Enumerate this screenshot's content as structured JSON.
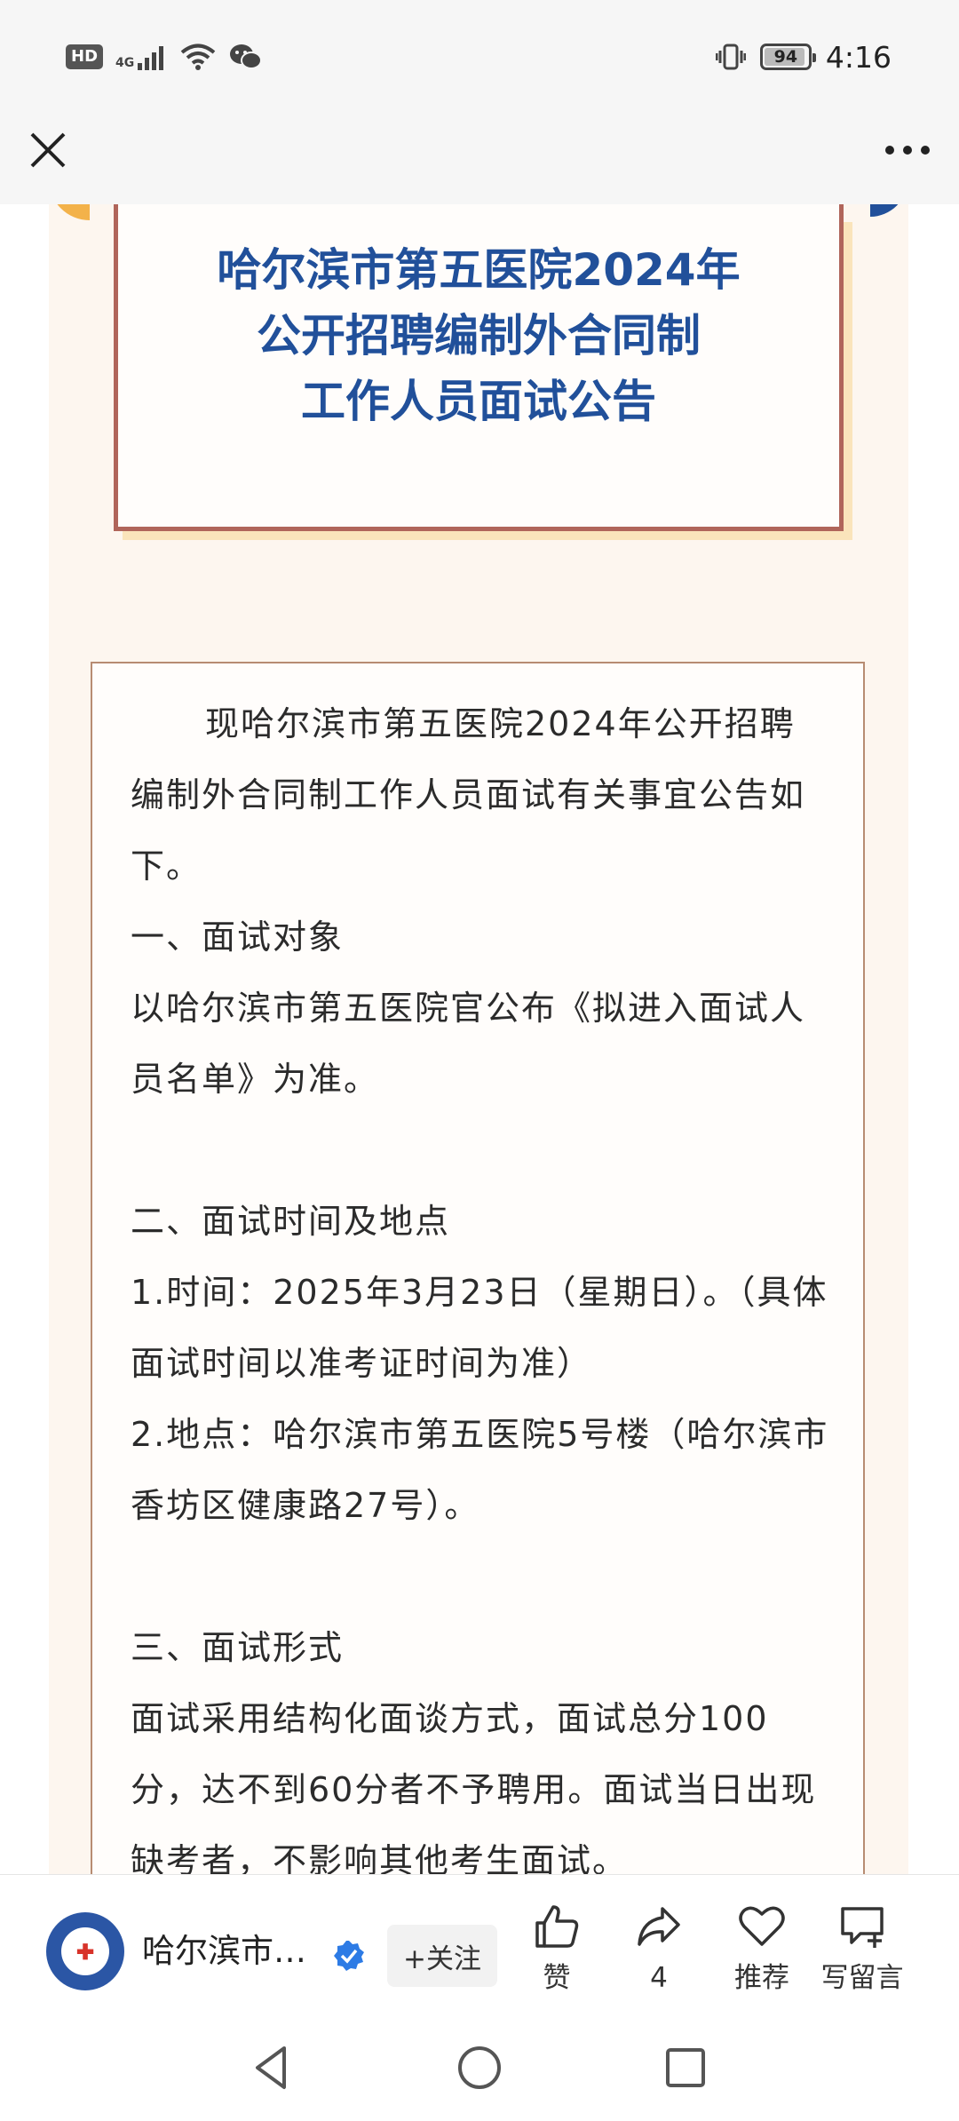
{
  "status_bar": {
    "hd": "HD",
    "network": "4G",
    "battery_level": "94",
    "battery_fraction": 0.94,
    "time": "4:16",
    "icons": [
      "signal-icon",
      "wifi-icon",
      "wechat-icon",
      "vibrate-icon",
      "battery-icon"
    ]
  },
  "title_bar": {
    "close_icon": "close-icon",
    "more_icon": "more-icon"
  },
  "article": {
    "title_lines": [
      "哈尔滨市第五医院2024年",
      "公开招聘编制外合同制",
      "工作人员面试公告"
    ],
    "paragraphs": [
      "现哈尔滨市第五医院2024年公开招聘编制外合同制工作人员面试有关事宜公告如下。",
      "一、面试对象",
      "以哈尔滨市第五医院官公布《拟进入面试人员名单》为准。",
      "二、面试时间及地点",
      "1.时间：2025年3月23日（星期日）。（具体面试时间以准考证时间为准）",
      "2.地点：哈尔滨市第五医院5号楼（哈尔滨市香坊区健康路27号）。",
      "三、面试形式",
      "面试采用结构化面谈方式，面试总分100分，达不到60分者不予聘用。面试当日出现缺考者，不影响其他考生面试。"
    ]
  },
  "bottom_bar": {
    "account_name": "哈尔滨市…",
    "follow_label": "+关注",
    "like_label": "赞",
    "share_count": "4",
    "recommend_label": "推荐",
    "comment_label": "写留言"
  },
  "nav": {
    "icons": [
      "back-icon",
      "home-icon",
      "recents-icon"
    ]
  },
  "colors": {
    "title_blue": "#21509a",
    "frame_red": "#b0655a",
    "paper": "#fdf6ef",
    "accent_gold": "#f3b24a"
  }
}
